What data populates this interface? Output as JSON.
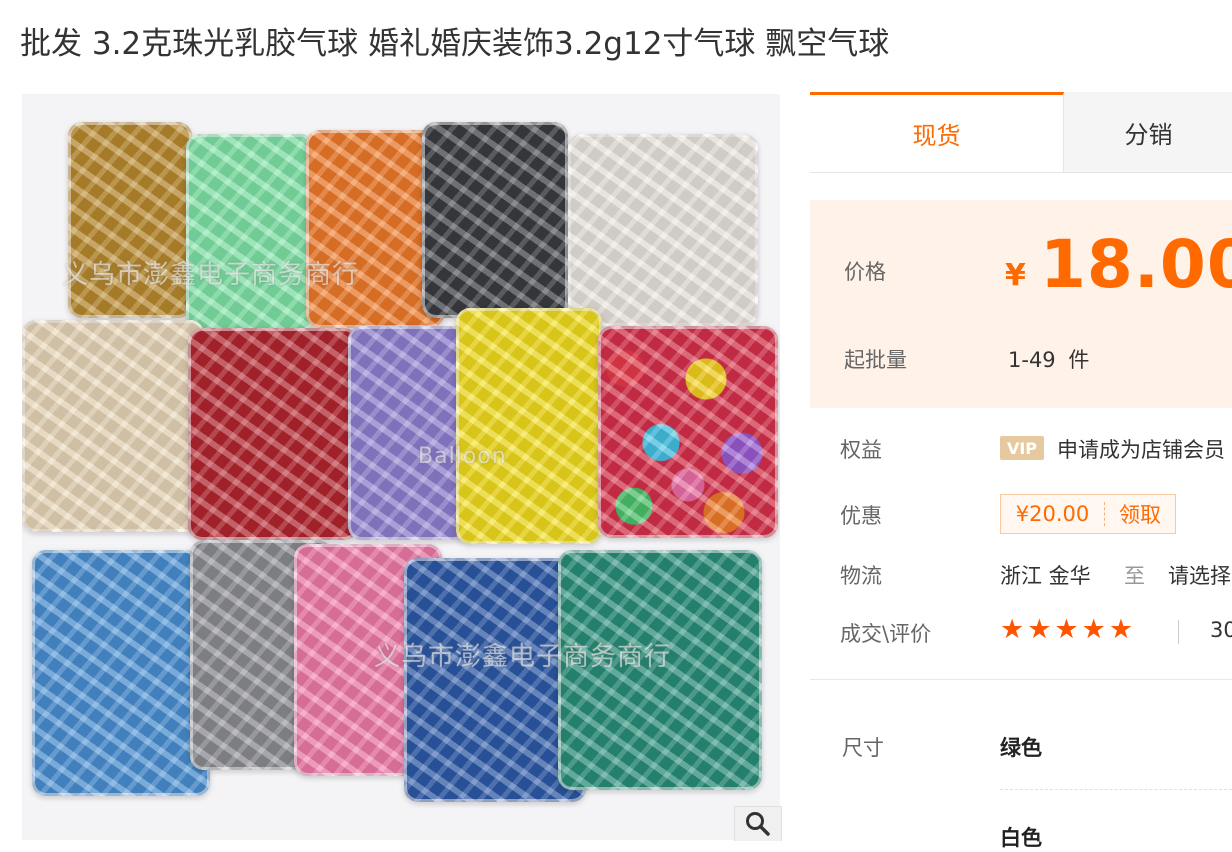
{
  "product": {
    "title": "批发 3.2克珠光乳胶气球 婚礼婚庆装饰3.2g12寸气球 飘空气球"
  },
  "gallery": {
    "watermark_top": "义乌市澎鑫电子商务商行",
    "watermark_bottom": "义乌市澎鑫电子商务商行",
    "watermark_mid": "Balloon",
    "zoom_icon": "magnifier-icon"
  },
  "tabs": [
    {
      "label": "现货",
      "active": true
    },
    {
      "label": "分销",
      "active": false
    }
  ],
  "price": {
    "label": "价格",
    "currency": "¥",
    "amount": "18.00",
    "min_order_label": "起批量",
    "min_order_value": "1-49",
    "min_order_unit": "件"
  },
  "benefits": {
    "label": "权益",
    "vip_badge": "VIP",
    "text": "申请成为店铺会员"
  },
  "discount": {
    "label": "优惠",
    "coupon_amount": "¥20.00",
    "coupon_action": "领取"
  },
  "logistics": {
    "label": "物流",
    "from": "浙江 金华",
    "to_word": "至",
    "select": "请选择"
  },
  "reviews": {
    "label": "成交\\评价",
    "stars": "★★★★★",
    "count_prefix": "30"
  },
  "sku": {
    "label": "尺寸",
    "options": [
      "绿色",
      "白色"
    ]
  },
  "colors": {
    "accent": "#ff6a00",
    "price_bg": "#fff2e8"
  }
}
